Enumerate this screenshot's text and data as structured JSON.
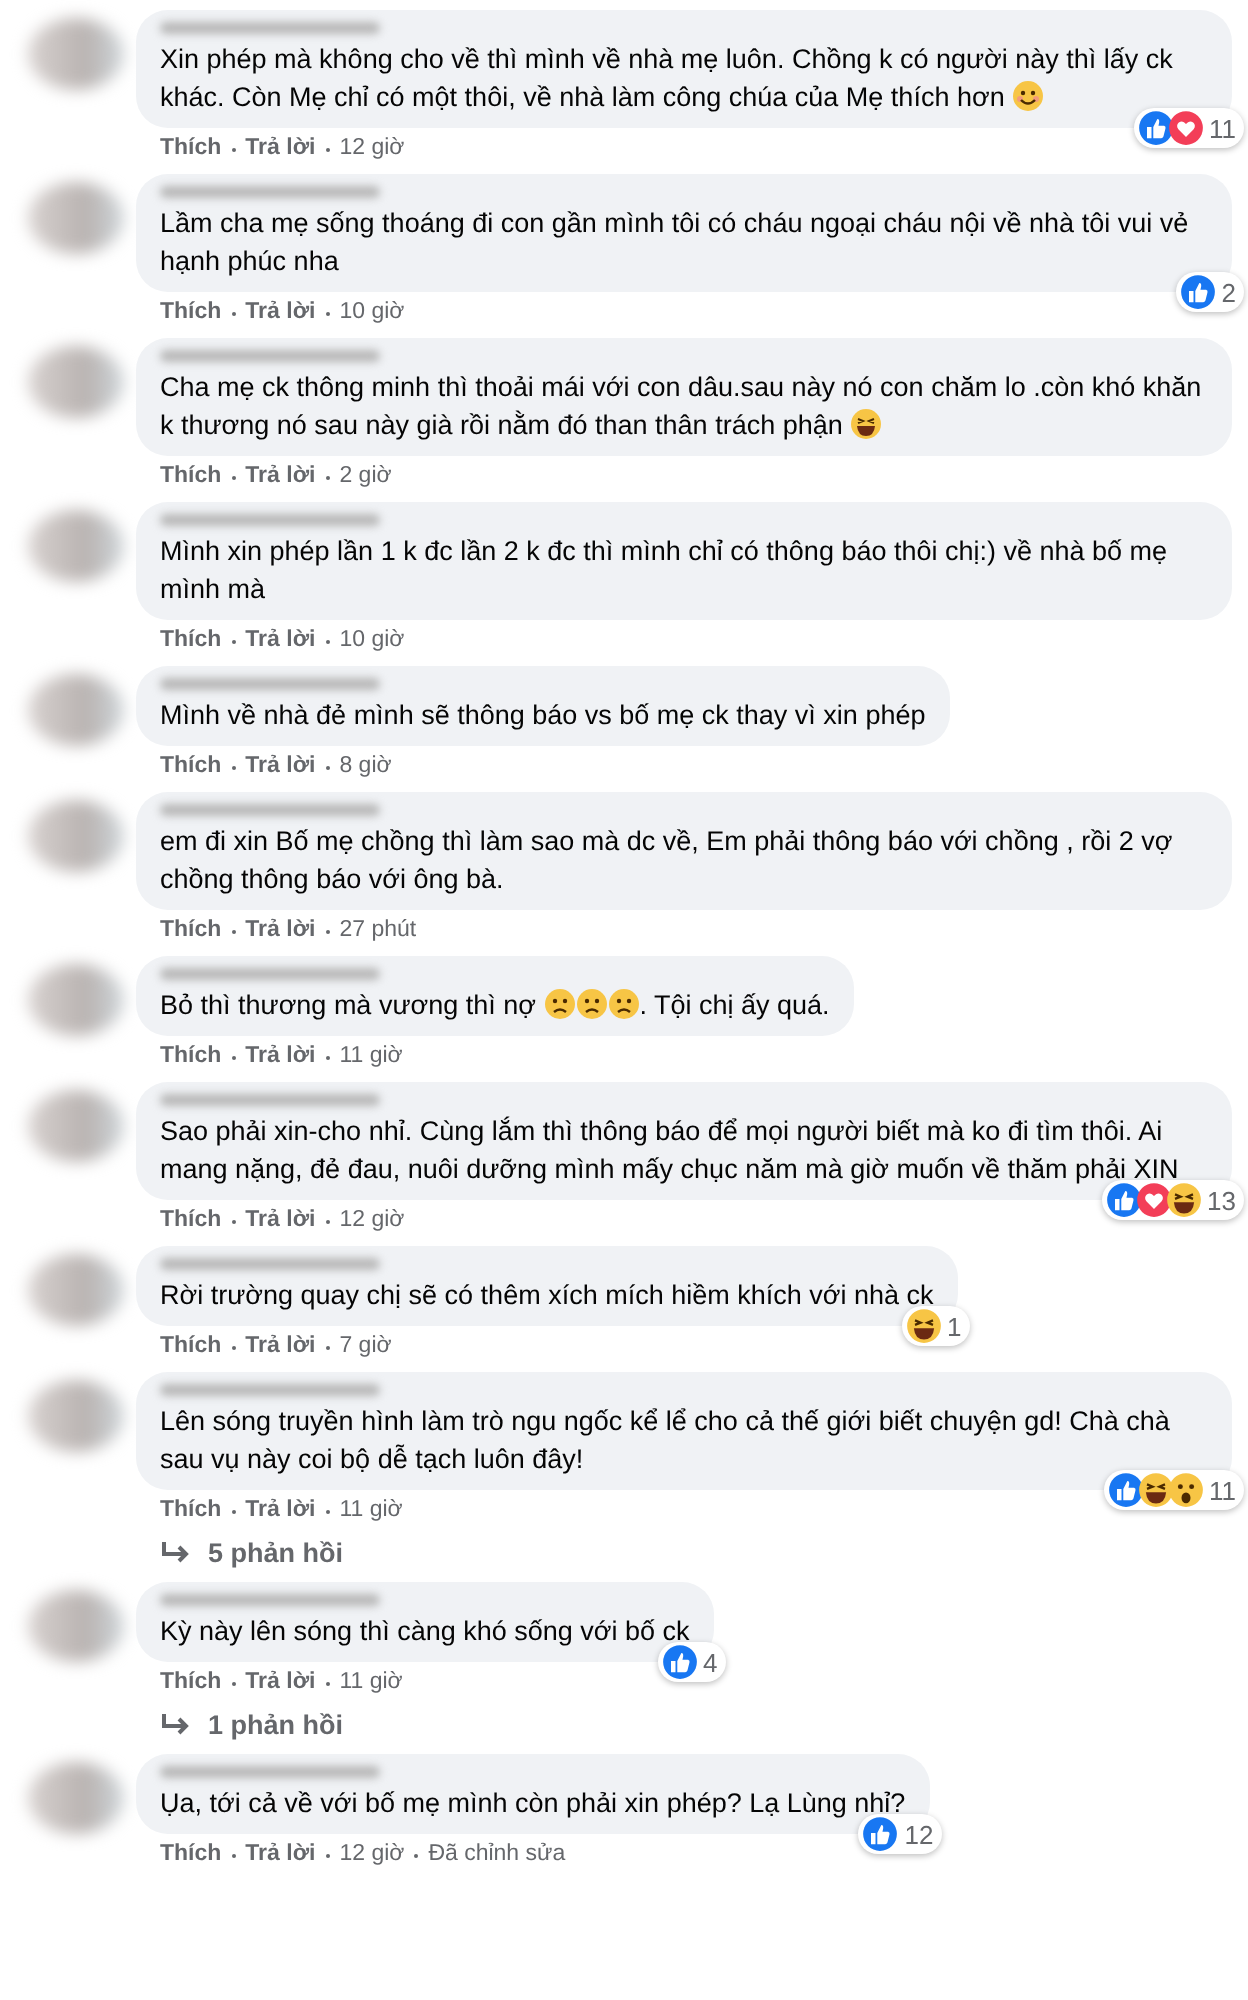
{
  "comments": [
    {
      "parts": [
        {
          "kind": "text",
          "text": "Xin phép mà không cho về thì mình về nhà mẹ luôn. Chồng k có người này thì lấy ck khác. Còn Mẹ chỉ có một thôi, về nhà làm công chúa của Mẹ thích hơn "
        },
        {
          "kind": "smile"
        }
      ],
      "like_label": "Thích",
      "reply_label": "Trả lời",
      "time": "12 giờ",
      "reactions": {
        "icons": [
          {
            "kind": "like"
          },
          {
            "kind": "love"
          }
        ],
        "count": "11"
      }
    },
    {
      "parts": [
        {
          "kind": "text",
          "text": "Lầm cha mẹ sống thoáng đi con gần mình tôi có cháu ngoại cháu nội về nhà tôi vui vẻ hạnh phúc nha"
        }
      ],
      "like_label": "Thích",
      "reply_label": "Trả lời",
      "time": "10 giờ",
      "reactions": {
        "icons": [
          {
            "kind": "like"
          }
        ],
        "count": "2"
      }
    },
    {
      "parts": [
        {
          "kind": "text",
          "text": "Cha mẹ ck thông minh thì thoải mái với con dâu.sau này nó con chăm lo .còn khó khăn k thương nó sau này già rồi nằm đó than thân trách phận "
        },
        {
          "kind": "laugh"
        }
      ],
      "like_label": "Thích",
      "reply_label": "Trả lời",
      "time": "2 giờ"
    },
    {
      "parts": [
        {
          "kind": "text",
          "text": "Mình xin phép lần 1 k đc lần 2 k đc thì mình chỉ có thông báo thôi chị:) về nhà bố mẹ mình mà"
        }
      ],
      "like_label": "Thích",
      "reply_label": "Trả lời",
      "time": "10 giờ"
    },
    {
      "parts": [
        {
          "kind": "text",
          "text": "Mình về nhà đẻ mình sẽ thông báo vs bố mẹ ck thay vì xin phép"
        }
      ],
      "like_label": "Thích",
      "reply_label": "Trả lời",
      "time": "8 giờ"
    },
    {
      "parts": [
        {
          "kind": "text",
          "text": "em đi xin Bố mẹ chồng thì làm sao mà dc về, Em phải thông báo với chồng , rồi 2 vợ chồng thông báo với ông bà."
        }
      ],
      "like_label": "Thích",
      "reply_label": "Trả lời",
      "time": "27 phút"
    },
    {
      "parts": [
        {
          "kind": "text",
          "text": "Bỏ thì thương mà vương thì nợ "
        },
        {
          "kind": "sad"
        },
        {
          "kind": "sad"
        },
        {
          "kind": "sad"
        },
        {
          "kind": "text",
          "text": ". Tội chị ấy quá."
        }
      ],
      "like_label": "Thích",
      "reply_label": "Trả lời",
      "time": "11 giờ"
    },
    {
      "parts": [
        {
          "kind": "text",
          "text": "Sao phải xin-cho nhỉ. Cùng lắm thì thông báo để mọi người biết mà ko đi tìm thôi. Ai mang nặng, đẻ đau, nuôi dưỡng mình mấy chục năm mà giờ muốn về thăm phải XIN"
        }
      ],
      "like_label": "Thích",
      "reply_label": "Trả lời",
      "time": "12 giờ",
      "reactions": {
        "icons": [
          {
            "kind": "like"
          },
          {
            "kind": "love"
          },
          {
            "kind": "haha"
          }
        ],
        "count": "13"
      }
    },
    {
      "parts": [
        {
          "kind": "text",
          "text": "Rời trường quay chị sẽ có thêm xích mích hiềm khích với nhà ck"
        }
      ],
      "like_label": "Thích",
      "reply_label": "Trả lời",
      "time": "7 giờ",
      "reactions": {
        "icons": [
          {
            "kind": "haha"
          }
        ],
        "count": "1"
      }
    },
    {
      "parts": [
        {
          "kind": "text",
          "text": "Lên sóng truyền hình làm trò ngu ngốc kể lể cho cả thế giới biết chuyện gd! Chà chà sau vụ này coi bộ dễ tạch luôn đây!"
        }
      ],
      "like_label": "Thích",
      "reply_label": "Trả lời",
      "time": "11 giờ",
      "reactions": {
        "icons": [
          {
            "kind": "like"
          },
          {
            "kind": "haha"
          },
          {
            "kind": "wow"
          }
        ],
        "count": "11"
      },
      "replies": "5 phản hồi"
    },
    {
      "parts": [
        {
          "kind": "text",
          "text": "Kỳ này lên sóng thì càng khó sống với bố ck"
        }
      ],
      "like_label": "Thích",
      "reply_label": "Trả lời",
      "time": "11 giờ",
      "reactions": {
        "icons": [
          {
            "kind": "like"
          }
        ],
        "count": "4"
      },
      "replies": "1 phản hồi"
    },
    {
      "parts": [
        {
          "kind": "text",
          "text": "Ụa, tới cả về với bố mẹ mình còn phải xin phép? Lạ Lùng nhỉ?"
        }
      ],
      "like_label": "Thích",
      "reply_label": "Trả lời",
      "time": "12 giờ",
      "edited": "Đã chỉnh sửa",
      "reactions": {
        "icons": [
          {
            "kind": "like"
          }
        ],
        "count": "12"
      }
    }
  ]
}
